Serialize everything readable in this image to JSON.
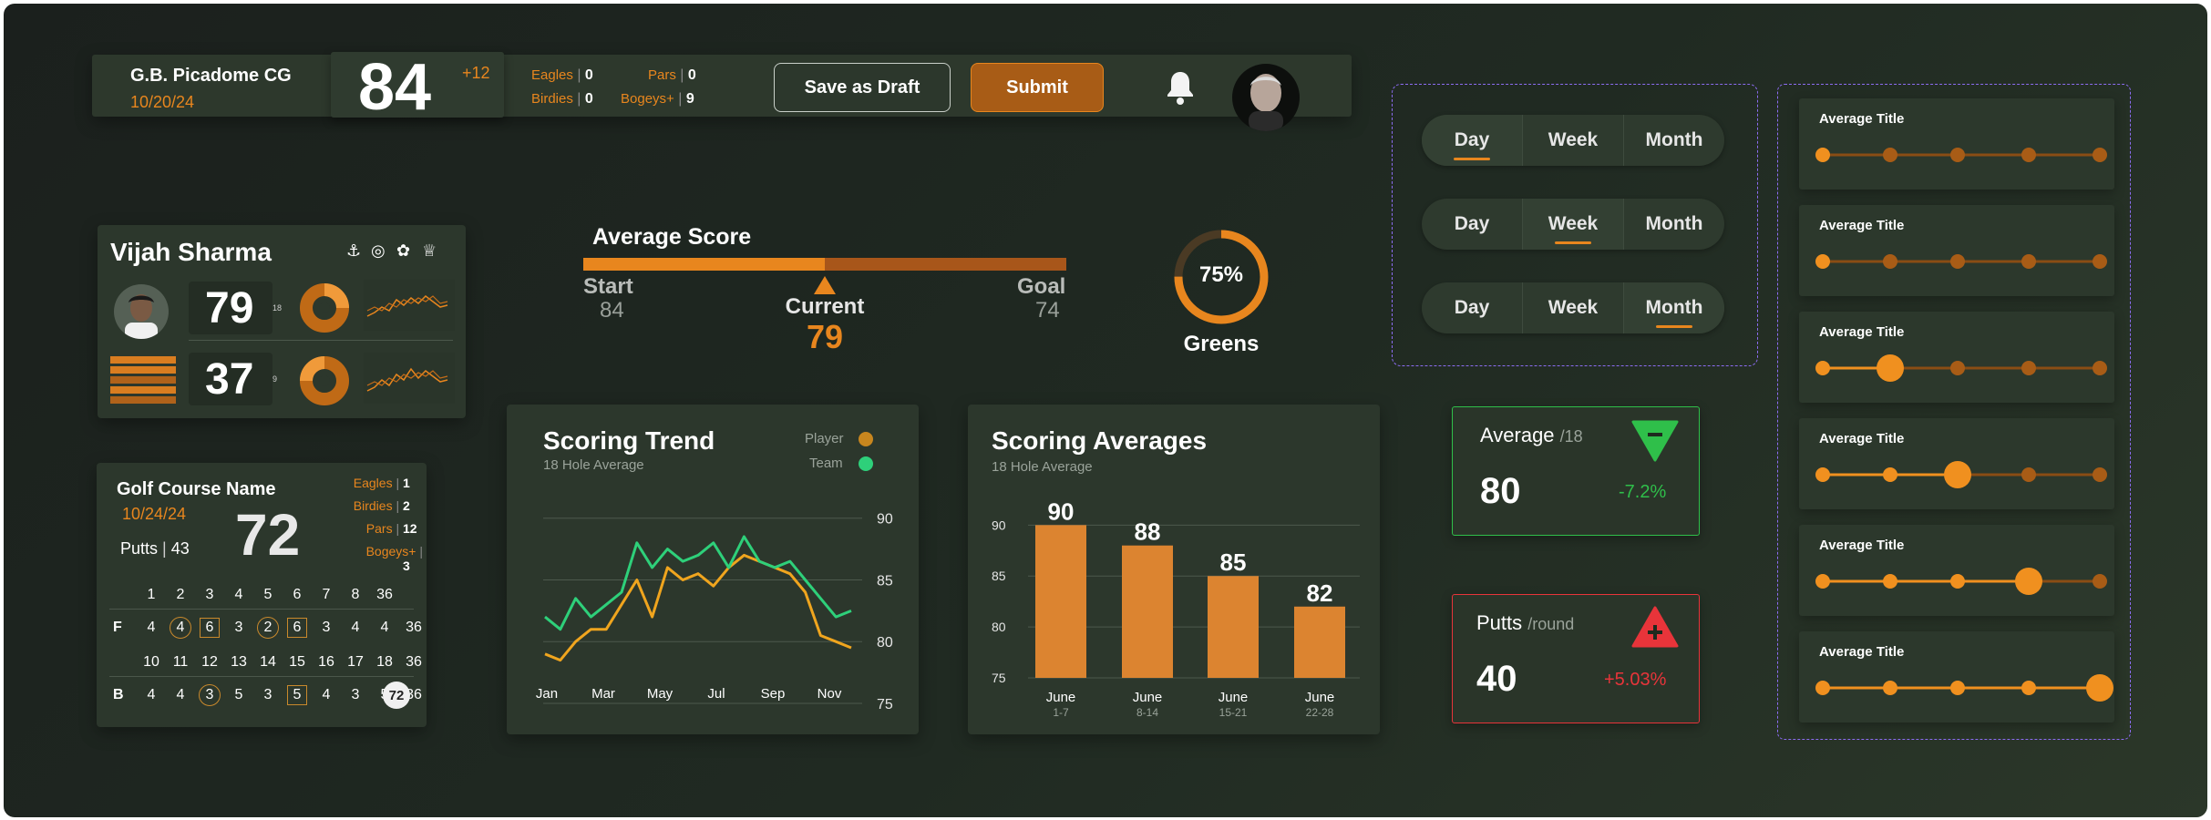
{
  "header": {
    "course": "G.B. Picadome CG",
    "date": "10/20/24",
    "score": "84",
    "over_par": "+12",
    "stats": [
      {
        "label": "Eagles",
        "value": "0"
      },
      {
        "label": "Birdies",
        "value": "0"
      },
      {
        "label": "Pars",
        "value": "0"
      },
      {
        "label": "Bogeys+",
        "value": "9"
      }
    ],
    "draft_label": "Save as Draft",
    "submit_label": "Submit"
  },
  "player": {
    "name": "Vijah Sharma",
    "score1": "79",
    "holes1": "18",
    "score2": "37",
    "holes2": "9"
  },
  "average_score": {
    "title": "Average Score",
    "start_label": "Start",
    "start_value": "84",
    "current_label": "Current",
    "current_value": "79",
    "goal_label": "Goal",
    "goal_value": "74",
    "progress": 0.5
  },
  "greens": {
    "percent_text": "75%",
    "percent": 75,
    "label": "Greens"
  },
  "segments": [
    {
      "options": [
        "Day",
        "Week",
        "Month"
      ],
      "active": "Day"
    },
    {
      "options": [
        "Day",
        "Week",
        "Month"
      ],
      "active": "Week"
    },
    {
      "options": [
        "Day",
        "Week",
        "Month"
      ],
      "active": "Month"
    }
  ],
  "sliders": [
    {
      "title": "Average Title",
      "level": 0
    },
    {
      "title": "Average Title",
      "level": 0
    },
    {
      "title": "Average Title",
      "level": 1
    },
    {
      "title": "Average Title",
      "level": 2
    },
    {
      "title": "Average Title",
      "level": 3
    },
    {
      "title": "Average Title",
      "level": 4
    }
  ],
  "scorecard": {
    "course": "Golf Course Name",
    "date": "10/24/24",
    "putts_label": "Putts",
    "putts_value": "43",
    "total": "72",
    "stats": [
      {
        "label": "Eagles",
        "value": "1"
      },
      {
        "label": "Birdies",
        "value": "2"
      },
      {
        "label": "Pars",
        "value": "12"
      },
      {
        "label": "Bogeys+",
        "value": "3"
      }
    ],
    "front_holes": [
      "1",
      "2",
      "3",
      "4",
      "5",
      "6",
      "7",
      "8",
      "36"
    ],
    "front_label": "F",
    "front_scores": [
      "4",
      "4",
      "6",
      "3",
      "2",
      "6",
      "3",
      "4",
      "4",
      "36"
    ],
    "back_holes": [
      "10",
      "11",
      "12",
      "13",
      "14",
      "15",
      "16",
      "17",
      "18",
      "36"
    ],
    "back_label": "B",
    "back_scores": [
      "4",
      "4",
      "3",
      "5",
      "3",
      "5",
      "4",
      "3",
      "5",
      "36"
    ],
    "back_total": "72"
  },
  "scoring_trend": {
    "title": "Scoring Trend",
    "subtitle": "18 Hole Average",
    "legend_player": "Player",
    "legend_team": "Team"
  },
  "scoring_averages": {
    "title": "Scoring Averages",
    "subtitle": "18 Hole Average"
  },
  "average_card": {
    "title": "Average",
    "unit": "/18",
    "value": "80",
    "change": "-7.2%"
  },
  "putts_card": {
    "title": "Putts",
    "unit": "/round",
    "value": "40",
    "change": "+5.03%"
  },
  "colors": {
    "accent": "#e8861e",
    "team": "#2ed07a",
    "up": "#2fbf4a",
    "down": "#e8343a"
  },
  "chart_data": [
    {
      "type": "line",
      "title": "Scoring Trend",
      "subtitle": "18 Hole Average",
      "x_ticks": [
        "Jan",
        "Mar",
        "May",
        "Jul",
        "Sep",
        "Nov"
      ],
      "ylim": [
        75,
        92
      ],
      "y_ticks": [
        75,
        80,
        85,
        90
      ],
      "series": [
        {
          "name": "Player",
          "values": [
            79,
            78.5,
            80,
            81,
            81,
            83,
            85,
            82,
            86,
            85,
            85.5,
            84.5,
            86,
            87,
            86.5,
            86,
            85.5,
            84,
            80.5,
            80,
            79.5
          ]
        },
        {
          "name": "Team",
          "values": [
            82,
            81,
            83.5,
            82,
            83,
            84,
            88,
            86,
            87.5,
            86.5,
            87,
            88,
            86,
            88.5,
            86.5,
            86,
            86.5,
            85,
            83.5,
            82,
            82.5
          ]
        }
      ]
    },
    {
      "type": "bar",
      "title": "Scoring Averages",
      "subtitle": "18 Hole Average",
      "categories": [
        "June\n1-7",
        "June\n8-14",
        "June\n15-21",
        "June\n22-28"
      ],
      "values": [
        90,
        88,
        85,
        82
      ],
      "ylim": [
        75,
        92
      ],
      "y_ticks": [
        75,
        80,
        85,
        90
      ]
    }
  ]
}
